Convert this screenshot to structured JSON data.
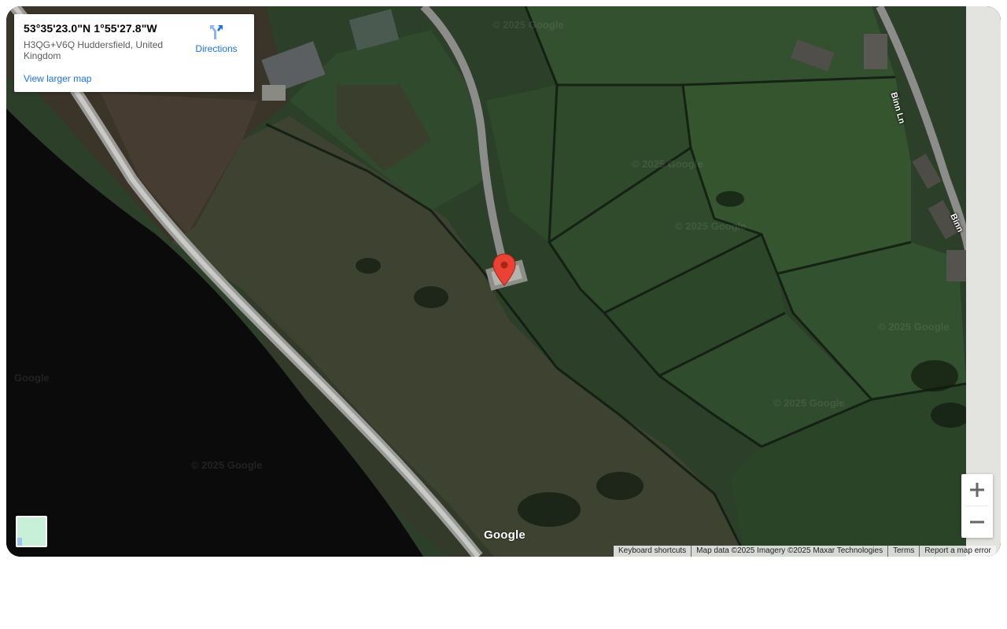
{
  "info_card": {
    "coordinates": "53°35'23.0\"N 1°55'27.8\"W",
    "address": "H3QG+V6Q Huddersfield, United Kingdom",
    "larger_map_link": "View larger map",
    "directions_label": "Directions"
  },
  "map": {
    "road_labels": [
      "Binn Ln",
      "Binn"
    ],
    "watermarks": [
      "© 2025 Google",
      "© 2025 Google",
      "© 2025 Google",
      "© 2025 Google",
      "© 2025 Google",
      "© 2025 Google",
      "Google",
      "© 2025 Google"
    ],
    "google_logo": "Google"
  },
  "controls": {
    "zoom_in_label": "+",
    "zoom_out_label": "−"
  },
  "attribution": {
    "keyboard_shortcuts": "Keyboard shortcuts",
    "map_data": "Map data ©2025 Imagery ©2025 Maxar Technologies",
    "terms": "Terms",
    "report_error": "Report a map error"
  },
  "colors": {
    "link_blue": "#1a73e8",
    "marker_red": "#ea4335",
    "field_green": "#2f4a2c",
    "water_dark": "#0b0b0b"
  }
}
